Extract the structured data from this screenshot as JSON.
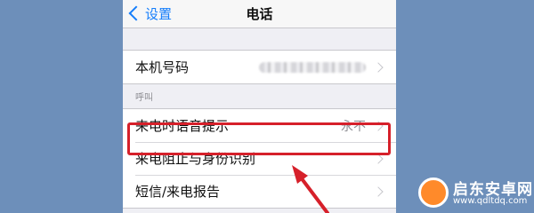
{
  "nav": {
    "back_label": "设置",
    "title": "电话"
  },
  "my_number": {
    "label": "本机号码",
    "value_obscured": true
  },
  "calls_section": {
    "header": "呼叫",
    "rows": [
      {
        "label": "来电时语音提示",
        "value": "永不"
      },
      {
        "label": "来电阻止与身份识别",
        "value": ""
      },
      {
        "label": "短信/来电报告",
        "value": ""
      }
    ]
  },
  "annotation": {
    "highlight_color": "#d6202a",
    "highlighted_row": "来电时语音提示"
  },
  "watermark": {
    "name": "启东安卓网",
    "url": "www.qdltdq.com"
  }
}
